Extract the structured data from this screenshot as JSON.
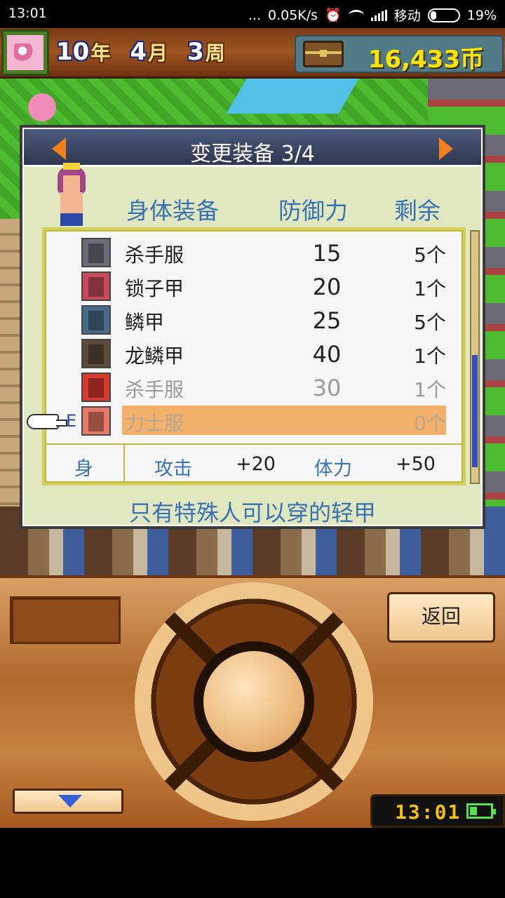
{
  "status_bar": {
    "time": "13:01",
    "dots": "...",
    "net_speed": "0.05K/s",
    "carrier": "移动",
    "battery": "19%"
  },
  "header": {
    "year_num": "10",
    "year_unit": "年",
    "month_num": "4",
    "month_unit": "月",
    "week_num": "3",
    "week_unit": "周",
    "money": "16,433币"
  },
  "dialog": {
    "title": "变更装备 3/4",
    "columns": {
      "name": "身体装备",
      "defense": "防御力",
      "remaining": "剩余"
    },
    "items": [
      {
        "name": "杀手服",
        "defense": "15",
        "qty": "5个",
        "color": "#6a6a78"
      },
      {
        "name": "锁子甲",
        "defense": "20",
        "qty": "1个",
        "color": "#c84a5a"
      },
      {
        "name": "鳞甲",
        "defense": "25",
        "qty": "5个",
        "color": "#4a6a8a"
      },
      {
        "name": "龙鳞甲",
        "defense": "40",
        "qty": "1个",
        "color": "#5a4a3a"
      },
      {
        "name": "杀手服",
        "defense": "30",
        "qty": "1个",
        "color": "#d83a30"
      },
      {
        "name": "力士服",
        "defense": "",
        "qty": "0个",
        "color": "#e87868",
        "equipped": "E"
      }
    ],
    "stats": {
      "slot": "身",
      "attack_label": "攻击",
      "attack_value": "+20",
      "hp_label": "体力",
      "hp_value": "+50"
    },
    "description": "只有特殊人可以穿的轻甲"
  },
  "controller": {
    "back_label": "返回",
    "clock": "13:01"
  },
  "colors": {
    "accent_blue": "#3773b5",
    "selection": "#f2b068",
    "money": "#ffe400"
  }
}
